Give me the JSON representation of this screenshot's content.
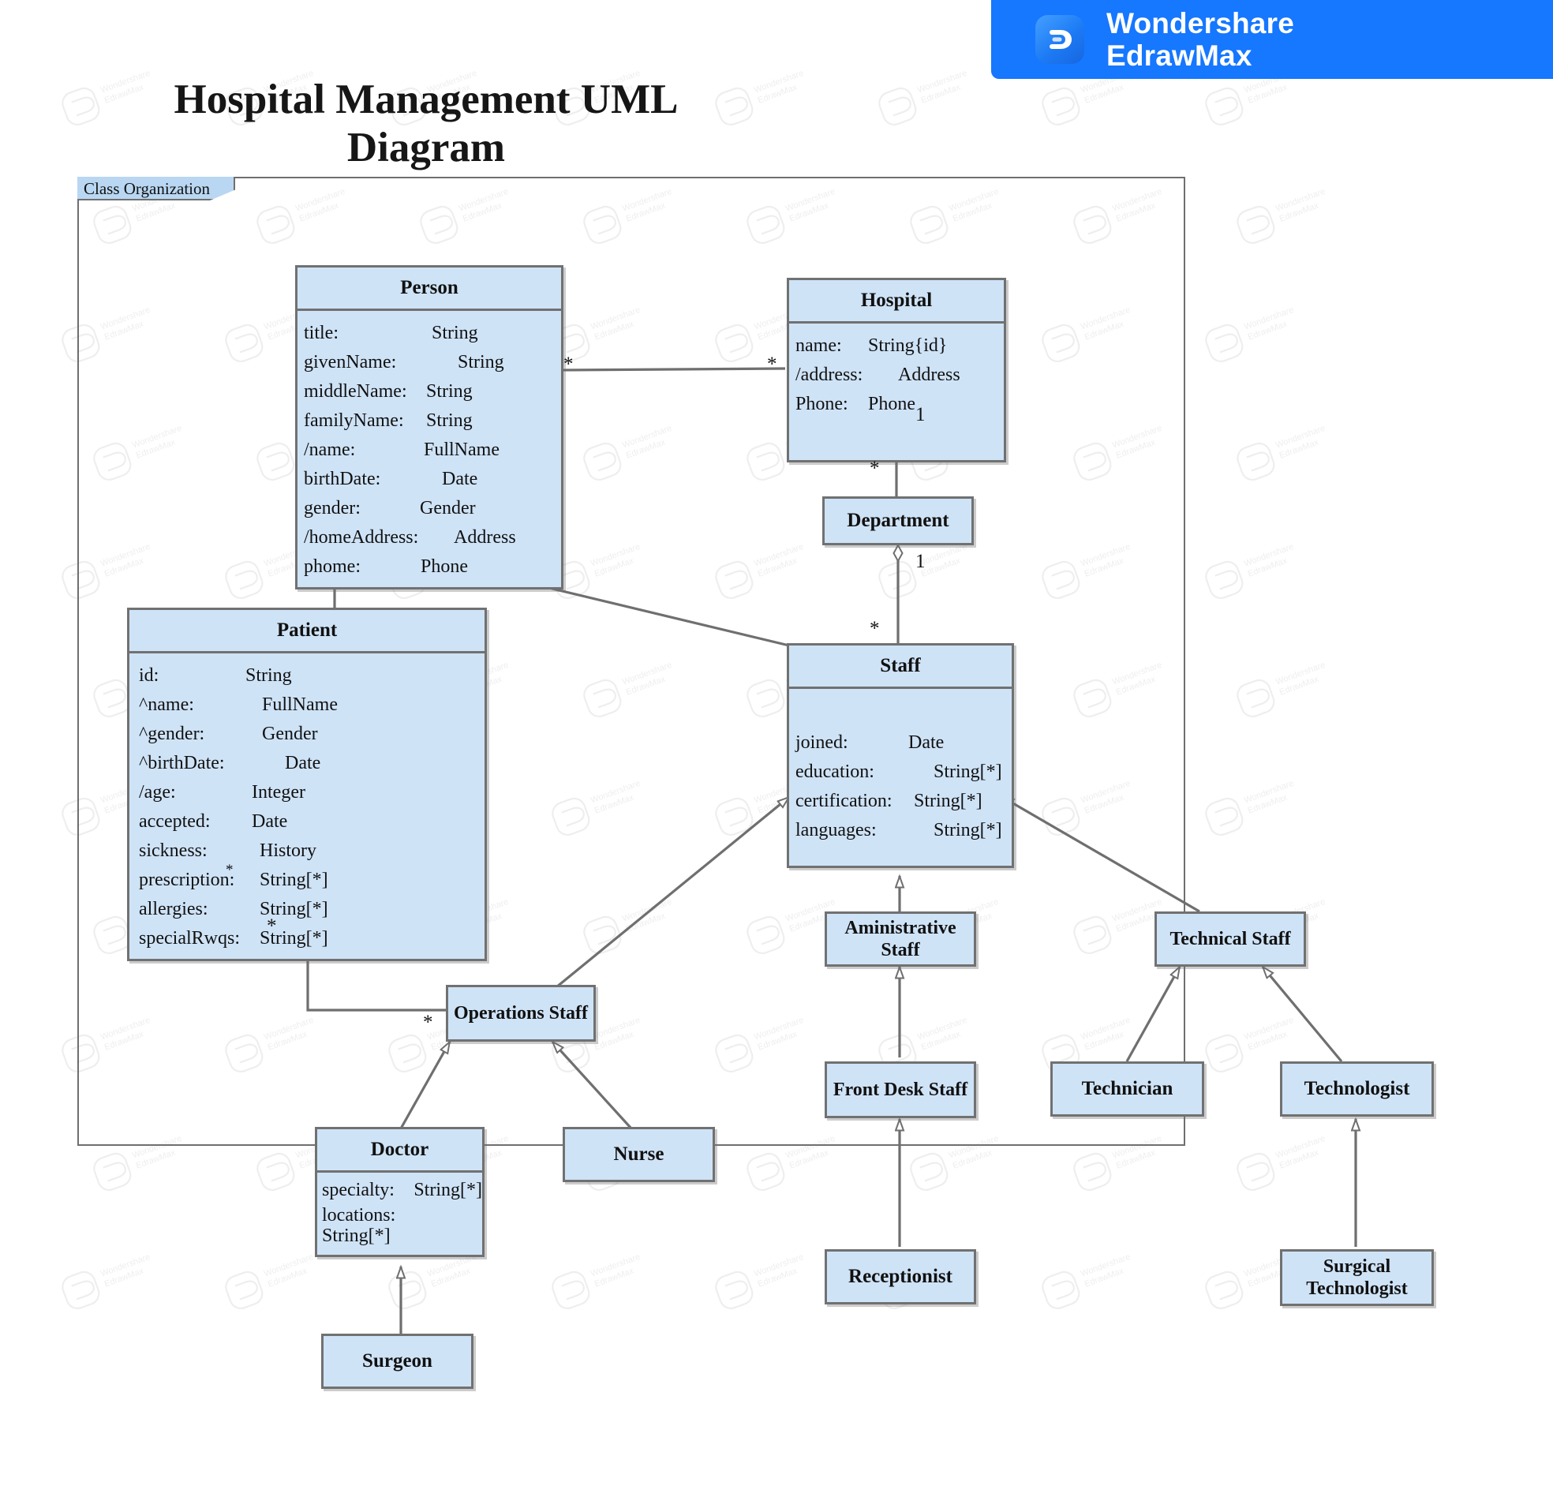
{
  "brand": {
    "line1": "Wondershare",
    "line2": "EdrawMax",
    "accent": "#1677ff",
    "icon": "edraw-d-icon"
  },
  "title": "Hospital Management UML Diagram",
  "frame": {
    "label": "Class Organization"
  },
  "theme": {
    "class_fill": "#cfe3f7",
    "class_border": "#717171",
    "tab_fill": "#b9d7f2"
  },
  "classes": {
    "person": {
      "name": "Person",
      "attributes": [
        {
          "name": "title:",
          "type": "String"
        },
        {
          "name": "givenName:",
          "type": "String"
        },
        {
          "name": "middleName:",
          "type": "String"
        },
        {
          "name": "familyName:",
          "type": "String"
        },
        {
          "name": "/name:",
          "type": "FullName"
        },
        {
          "name": "birthDate:",
          "type": "Date"
        },
        {
          "name": "gender:",
          "type": "Gender"
        },
        {
          "name": "/homeAddress:",
          "type": "Address"
        },
        {
          "name": "phome:",
          "type": "Phone"
        }
      ]
    },
    "hospital": {
      "name": "Hospital",
      "attributes": [
        {
          "name": "name:",
          "type": "String{id}"
        },
        {
          "name": "/address:",
          "type": "Address"
        },
        {
          "name": "Phone:",
          "type": "Phone"
        }
      ]
    },
    "department": {
      "name": "Department"
    },
    "patient": {
      "name": "Patient",
      "attributes": [
        {
          "name": "id:",
          "type": "String"
        },
        {
          "name": "^name:",
          "type": "FullName"
        },
        {
          "name": "^gender:",
          "type": "Gender"
        },
        {
          "name": "^birthDate:",
          "type": "Date"
        },
        {
          "name": "/age:",
          "type": "Integer"
        },
        {
          "name": "accepted:",
          "type": "Date"
        },
        {
          "name": "sickness:",
          "type": "History"
        },
        {
          "name": "prescription:",
          "type": "String[*]"
        },
        {
          "name": "allergies:",
          "type": "String[*]"
        },
        {
          "name": "specialRwqs:",
          "type": "String[*]"
        }
      ]
    },
    "staff": {
      "name": "Staff",
      "attributes": [
        {
          "name": "joined:",
          "type": "Date"
        },
        {
          "name": "education:",
          "type": "String[*]"
        },
        {
          "name": "certification:",
          "type": "String[*]"
        },
        {
          "name": "languages:",
          "type": "String[*]"
        }
      ]
    },
    "administrative_staff": {
      "name": "Aministrative Staff"
    },
    "technical_staff": {
      "name": "Technical Staff"
    },
    "front_desk_staff": {
      "name": "Front Desk Staff"
    },
    "receptionist": {
      "name": "Receptionist"
    },
    "technician": {
      "name": "Technician"
    },
    "technologist": {
      "name": "Technologist"
    },
    "surgical_technologist": {
      "name": "Surgical Technologist"
    },
    "operations_staff": {
      "name": "Operations Staff"
    },
    "doctor": {
      "name": "Doctor",
      "attributes": [
        {
          "name": "specialty:",
          "type": "String[*]"
        },
        {
          "name": "locations:",
          "type": "String[*]"
        }
      ]
    },
    "nurse": {
      "name": "Nurse"
    },
    "surgeon": {
      "name": "Surgeon"
    }
  },
  "multiplicities": {
    "person_to_hospital_left": "*",
    "person_to_hospital_right": "*",
    "hospital_bottom": "1",
    "department_top": "*",
    "department_bottom": "1",
    "staff_top": "*",
    "patient_bottom": "*",
    "patient_attr_star": "*",
    "operations_staff_left": "*"
  },
  "relationships": [
    {
      "from": "Person",
      "to": "Hospital",
      "type": "association",
      "source_mult": "*",
      "target_mult": "*"
    },
    {
      "from": "Hospital",
      "to": "Department",
      "type": "aggregation",
      "source_mult": "1",
      "target_mult": "*"
    },
    {
      "from": "Department",
      "to": "Staff",
      "type": "aggregation",
      "source_mult": "1",
      "target_mult": "*"
    },
    {
      "from": "Patient",
      "to": "Person",
      "type": "generalization"
    },
    {
      "from": "Staff",
      "to": "Person",
      "type": "generalization"
    },
    {
      "from": "Patient",
      "to": "Operations Staff",
      "type": "association",
      "source_mult": "*",
      "target_mult": "*"
    },
    {
      "from": "Operations Staff",
      "to": "Staff",
      "type": "generalization"
    },
    {
      "from": "Aministrative Staff",
      "to": "Staff",
      "type": "generalization"
    },
    {
      "from": "Technical Staff",
      "to": "Staff",
      "type": "generalization"
    },
    {
      "from": "Front Desk Staff",
      "to": "Aministrative Staff",
      "type": "generalization"
    },
    {
      "from": "Receptionist",
      "to": "Front Desk Staff",
      "type": "generalization"
    },
    {
      "from": "Technician",
      "to": "Technical Staff",
      "type": "generalization"
    },
    {
      "from": "Technologist",
      "to": "Technical Staff",
      "type": "generalization"
    },
    {
      "from": "Surgical Technologist",
      "to": "Technologist",
      "type": "generalization"
    },
    {
      "from": "Doctor",
      "to": "Operations Staff",
      "type": "generalization"
    },
    {
      "from": "Nurse",
      "to": "Operations Staff",
      "type": "generalization"
    },
    {
      "from": "Surgeon",
      "to": "Doctor",
      "type": "generalization"
    }
  ],
  "watermark": {
    "text_line1": "Wondershare",
    "text_line2": "EdrawMax"
  }
}
